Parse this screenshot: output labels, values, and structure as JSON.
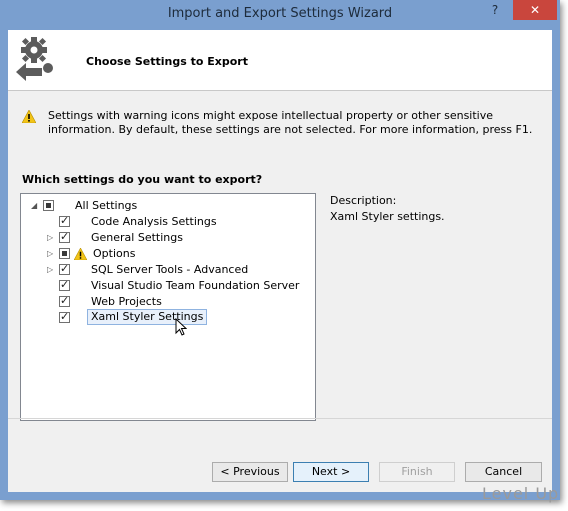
{
  "window": {
    "title": "Import and Export Settings Wizard",
    "help_glyph": "?",
    "close_glyph": "✕"
  },
  "header": {
    "heading": "Choose Settings to Export"
  },
  "warning": {
    "text": "Settings with warning icons might expose intellectual property or other sensitive information. By default, these settings are not selected. For more information, press F1."
  },
  "tree": {
    "question": "Which settings do you want to export?",
    "items": [
      {
        "label": "All Settings",
        "level": 0,
        "expander": "◢",
        "check": "partial",
        "warn": false,
        "selected": false
      },
      {
        "label": "Code Analysis Settings",
        "level": 1,
        "expander": "",
        "check": "checked",
        "warn": false,
        "selected": false
      },
      {
        "label": "General Settings",
        "level": 1,
        "expander": "▷",
        "check": "checked",
        "warn": false,
        "selected": false
      },
      {
        "label": "Options",
        "level": 1,
        "expander": "▷",
        "check": "partial",
        "warn": true,
        "selected": false
      },
      {
        "label": "SQL Server Tools - Advanced",
        "level": 1,
        "expander": "▷",
        "check": "checked",
        "warn": false,
        "selected": false
      },
      {
        "label": "Visual Studio Team Foundation Server",
        "level": 1,
        "expander": "",
        "check": "checked",
        "warn": false,
        "selected": false
      },
      {
        "label": "Web Projects",
        "level": 1,
        "expander": "",
        "check": "checked",
        "warn": false,
        "selected": false
      },
      {
        "label": "Xaml Styler Settings",
        "level": 1,
        "expander": "",
        "check": "checked",
        "warn": false,
        "selected": true
      }
    ]
  },
  "description": {
    "label": "Description:",
    "text": "Xaml Styler settings."
  },
  "buttons": {
    "previous": "< Previous",
    "next": "Next >",
    "finish": "Finish",
    "cancel": "Cancel"
  },
  "watermark": "Level Up",
  "colors": {
    "titlebar": "#7a9fcf",
    "close": "#c9463d",
    "warning": "#f2c418"
  }
}
